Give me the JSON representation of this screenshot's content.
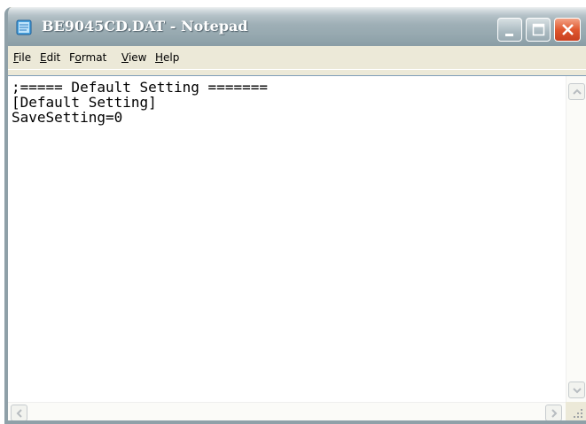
{
  "window": {
    "title": "BE9045CD.DAT - Notepad",
    "icon": "notepad-icon",
    "controls": [
      "minimize-icon",
      "maximize-icon",
      "close-icon"
    ]
  },
  "menu": {
    "items": [
      {
        "accel": "F",
        "rest": "ile"
      },
      {
        "accel": "E",
        "rest": "dit"
      },
      {
        "pre": "F",
        "accel": "o",
        "rest": "rmat"
      },
      {
        "accel": "V",
        "rest": "iew"
      },
      {
        "accel": "H",
        "rest": "elp"
      }
    ]
  },
  "document": {
    "content": ";===== Default Setting =======\n[Default Setting]\nSaveSetting=0"
  },
  "colors": {
    "titlebar": "#9eafb6",
    "close_button": "#e0582f",
    "chrome": "#ece9d8"
  }
}
